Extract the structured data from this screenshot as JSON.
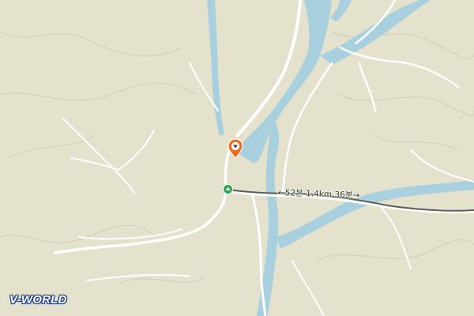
{
  "map": {
    "brand": "V-WORLD",
    "route_label": "←52분  1.4km  36분→",
    "colors": {
      "land": "#e4e2cd",
      "water": "#a9d0df",
      "road": "#ffffff",
      "contour": "#c9c7b1",
      "route": "#5b6157",
      "pin": "#f06a1c",
      "start": "#2ea84f"
    },
    "icons": {
      "destination": "map-pin-icon",
      "start": "start-marker-icon"
    }
  }
}
